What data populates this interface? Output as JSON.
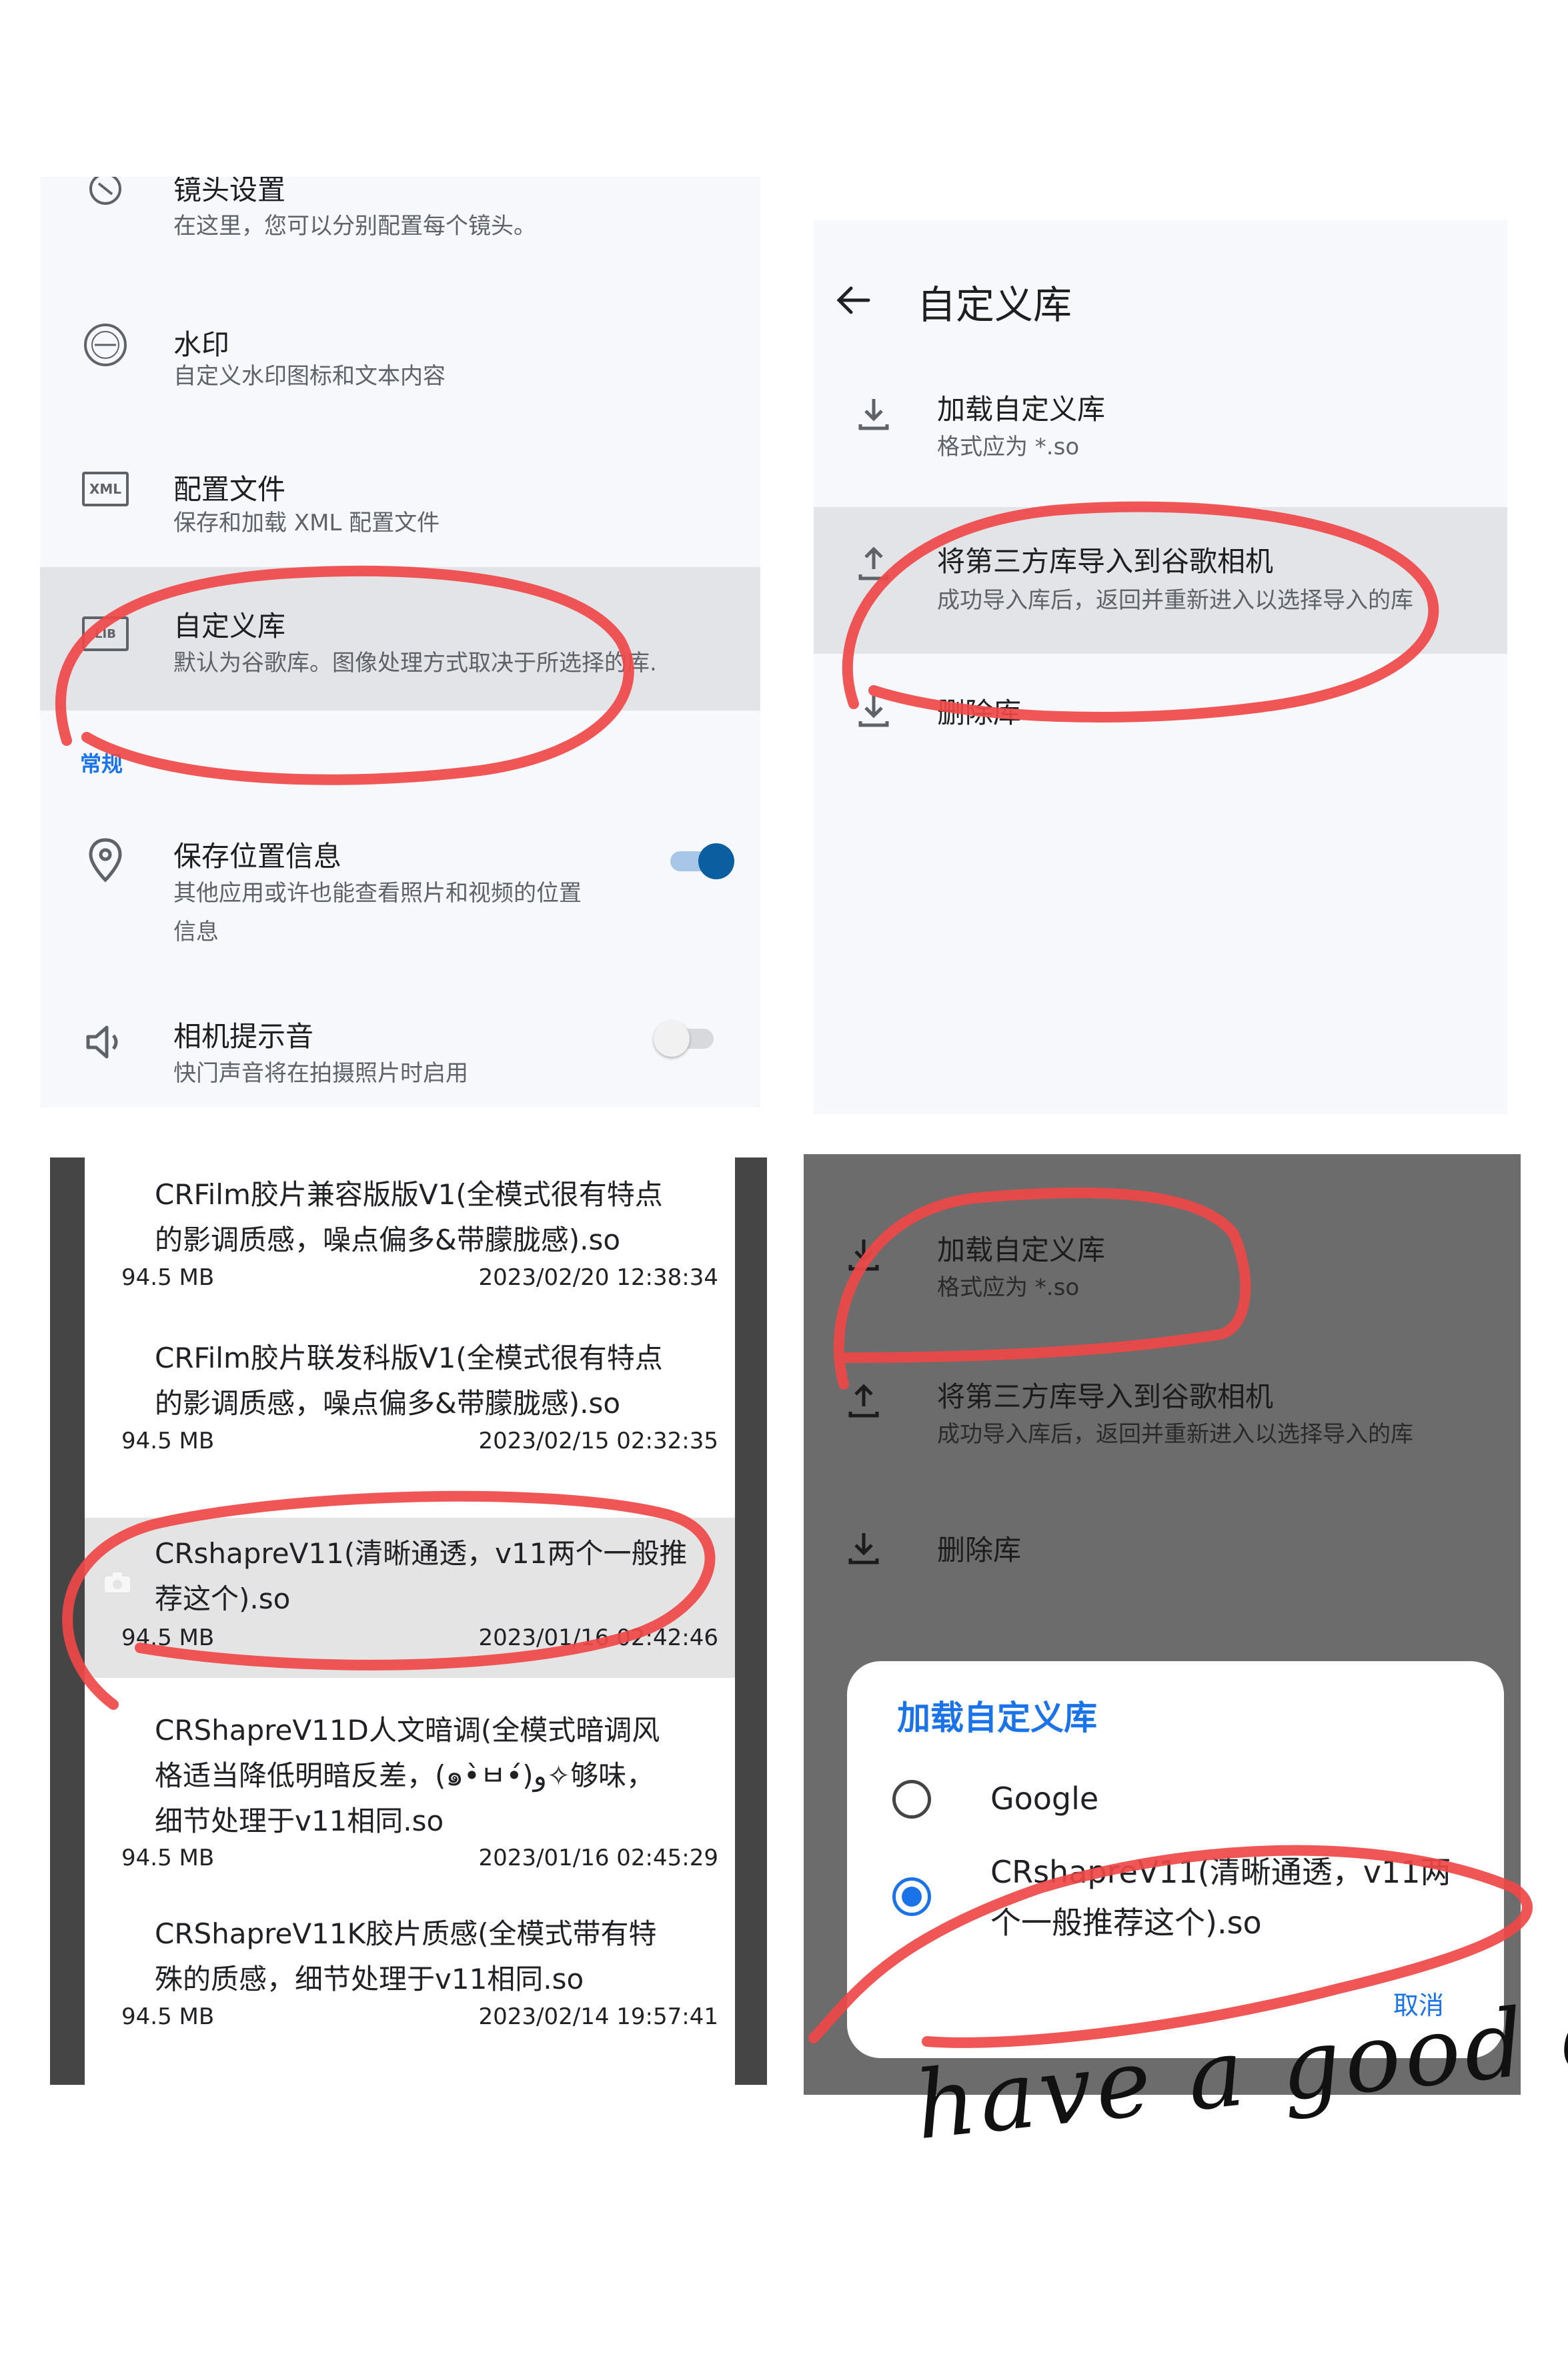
{
  "panel1": {
    "rows": [
      {
        "title": "镜头设置",
        "subtitle": "在这里，您可以分别配置每个镜头。",
        "icon": "lens-icon"
      },
      {
        "title": "水印",
        "subtitle": "自定义水印图标和文本内容",
        "icon": "watermark-icon"
      },
      {
        "title": "配置文件",
        "subtitle": "保存和加载 XML 配置文件",
        "icon": "xml-file-icon",
        "icon_text": "XML"
      },
      {
        "title": "自定义库",
        "subtitle": "默认为谷歌库。图像处理方式取决于所选择的库.",
        "icon": "library-icon",
        "icon_text": "LIB"
      }
    ],
    "section_label": "常规",
    "location": {
      "title": "保存位置信息",
      "subtitle_line1": "其他应用或许也能查看照片和视频的位置",
      "subtitle_line2": "信息",
      "enabled": true
    },
    "sound": {
      "title": "相机提示音",
      "subtitle": "快门声音将在拍摄照片时启用",
      "enabled": false
    },
    "colors": {
      "accent": "#1a73e8",
      "toggle_on": "#0b5fa0",
      "highlight": "#e3e4e8"
    }
  },
  "panel2": {
    "title": "自定义库",
    "rows": [
      {
        "title": "加载自定义库",
        "subtitle": "格式应为 *.so",
        "icon": "download-icon"
      },
      {
        "title": "将第三方库导入到谷歌相机",
        "subtitle": "成功导入库后，返回并重新进入以选择导入的库",
        "icon": "upload-icon"
      },
      {
        "title": "删除库",
        "subtitle": "",
        "icon": "download-icon"
      }
    ]
  },
  "panel3": {
    "files": [
      {
        "line1": "CRFilm胶片兼容版版V1(全模式很有特点",
        "line2": "的影调质感，噪点偏多&带朦胧感).so",
        "line3": "",
        "size": "94.5 MB",
        "date": "2023/02/20 12:38:34"
      },
      {
        "line1": "CRFilm胶片联发科版V1(全模式很有特点",
        "line2": "的影调质感，噪点偏多&带朦胧感).so",
        "line3": "",
        "size": "94.5 MB",
        "date": "2023/02/15 02:32:35"
      },
      {
        "line1": "CRshapreV11(清晰通透，v11两个一般推",
        "line2": "荐这个).so",
        "line3": "",
        "size": "94.5 MB",
        "date": "2023/01/16 02:42:46"
      },
      {
        "line1": "CRShapreV11D人文暗调(全模式暗调风",
        "line2": "格适当降低明暗反差，(๑•̀ㅂ•́)و✧够味，",
        "line3": "细节处理于v11相同.so",
        "size": "94.5 MB",
        "date": "2023/01/16 02:45:29"
      },
      {
        "line1": "CRShapreV11K胶片质感(全模式带有特",
        "line2": "殊的质感，细节处理于v11相同.so",
        "line3": "",
        "size": "94.5 MB",
        "date": "2023/02/14 19:57:41"
      }
    ]
  },
  "panel4": {
    "rows": [
      {
        "title": "加载自定义库",
        "subtitle": "格式应为 *.so"
      },
      {
        "title": "将第三方库导入到谷歌相机",
        "subtitle": "成功导入库后，返回并重新进入以选择导入的库"
      },
      {
        "title": "删除库",
        "subtitle": ""
      }
    ],
    "dialog": {
      "title": "加载自定义库",
      "options": [
        {
          "line1": "Google",
          "line2": "",
          "selected": false
        },
        {
          "line1": "CRshapreV11(清晰通透，v11两",
          "line2": "个一般推荐这个).so",
          "selected": true
        }
      ],
      "cancel": "取消"
    }
  },
  "signature": "have a good day."
}
